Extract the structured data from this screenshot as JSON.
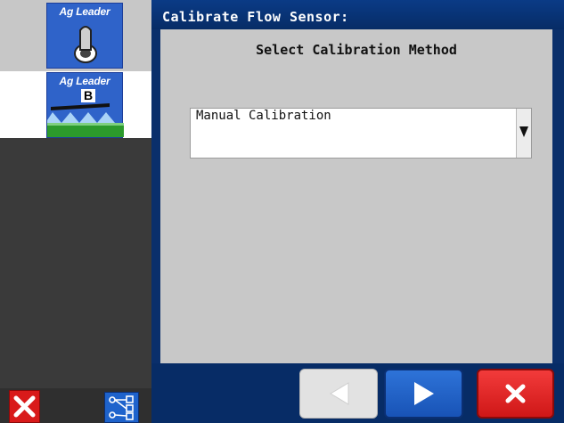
{
  "sidebar": {
    "tiles": [
      {
        "brand": "Ag Leader",
        "icon": "joystick-icon"
      },
      {
        "brand": "Ag Leader",
        "badge": "B",
        "icon": "sprayer-boom-icon"
      }
    ],
    "bottom_buttons": [
      {
        "icon": "close-x-icon",
        "color": "#d91a1a"
      },
      {
        "icon": "network-diagram-icon",
        "color": "#1e63cc"
      }
    ]
  },
  "window": {
    "title": "Calibrate Flow Sensor:",
    "subtitle": "Select Calibration Method"
  },
  "calibration_method": {
    "selected": "Manual Calibration",
    "arrow_icon": "dropdown-arrow-icon"
  },
  "nav": {
    "back_icon": "back-arrow-icon",
    "next_icon": "next-arrow-icon",
    "cancel_icon": "cancel-x-icon"
  },
  "colors": {
    "title_bar": "#0a3b86",
    "content_bg": "#c8c8c8",
    "accent_blue": "#2f63c9",
    "cancel_red": "#e02424"
  }
}
